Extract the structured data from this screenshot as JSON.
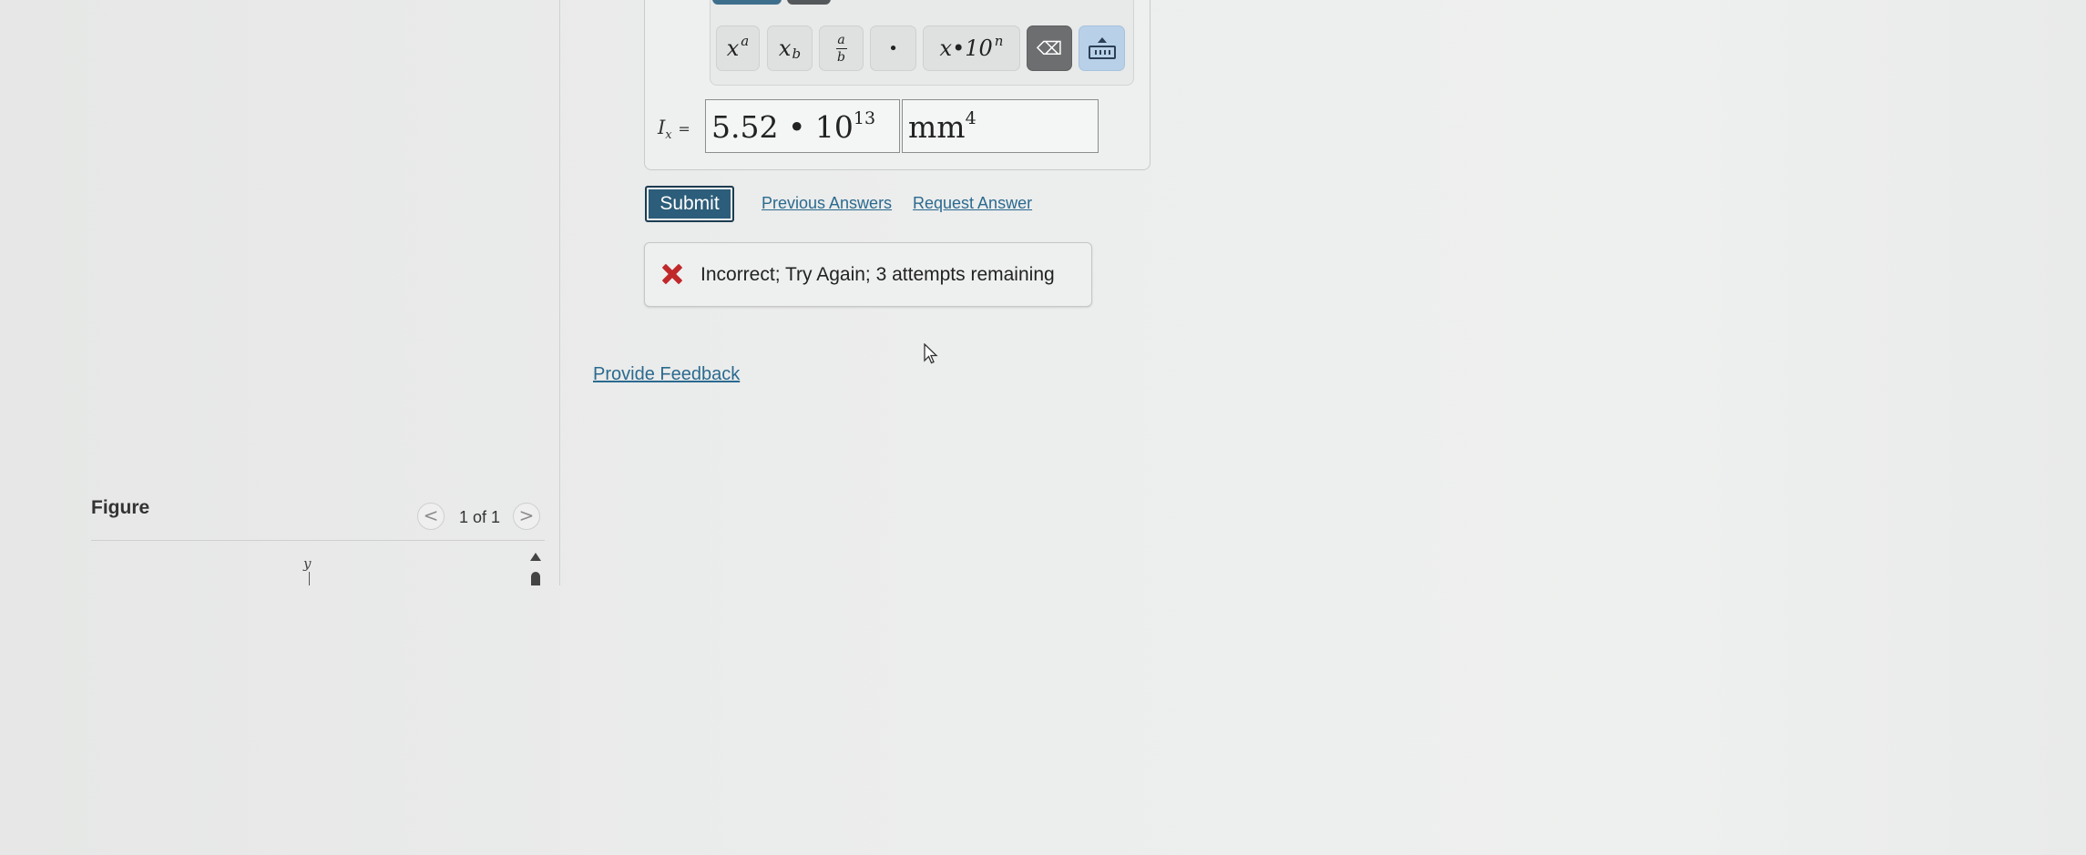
{
  "toolbar": {
    "buttons": [
      {
        "name": "superscript",
        "base": "x",
        "script": "a"
      },
      {
        "name": "subscript",
        "base": "x",
        "script": "b"
      },
      {
        "name": "fraction",
        "numerator": "a",
        "denominator": "b"
      },
      {
        "name": "dot",
        "label": "•"
      },
      {
        "name": "scientific",
        "label": "x•10",
        "exponent": "n"
      },
      {
        "name": "backspace",
        "label": "⌫"
      },
      {
        "name": "keyboard",
        "label": ""
      }
    ]
  },
  "answer": {
    "variable": "I",
    "variable_sub": "x",
    "equals": "=",
    "value_mantissa": "5.52 • 10",
    "value_exponent": "13",
    "unit_base": "mm",
    "unit_exponent": "4"
  },
  "actions": {
    "submit_label": "Submit",
    "previous_answers_label": "Previous Answers",
    "request_answer_label": "Request Answer"
  },
  "feedback": {
    "message": "Incorrect; Try Again; 3 attempts remaining",
    "status_color": "#c0282a"
  },
  "provide_feedback_label": "Provide Feedback",
  "figure": {
    "title": "Figure",
    "prev_symbol": "<",
    "next_symbol": ">",
    "counter": "1 of 1",
    "axis_label": "y"
  }
}
